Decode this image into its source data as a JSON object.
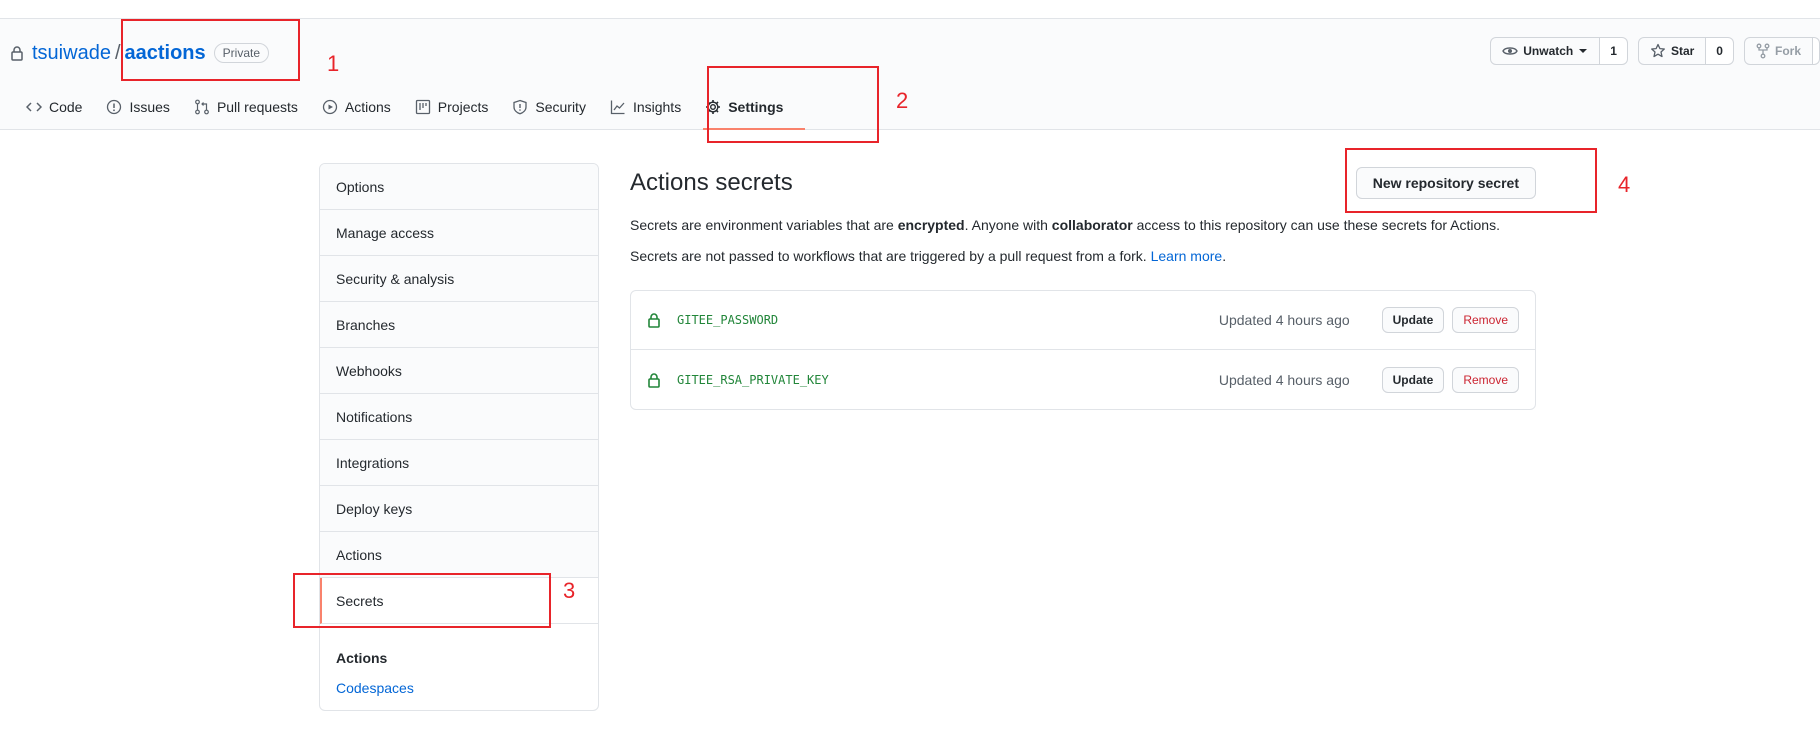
{
  "repo": {
    "owner": "tsuiwade",
    "separator": "/",
    "name": "aactions",
    "visibility": "Private"
  },
  "head_actions": {
    "watch_label": "Unwatch",
    "watch_count": "1",
    "star_label": "Star",
    "star_count": "0",
    "fork_label": "Fork"
  },
  "tabs": [
    {
      "label": "Code",
      "icon": "code-icon"
    },
    {
      "label": "Issues",
      "icon": "issue-icon"
    },
    {
      "label": "Pull requests",
      "icon": "pull-request-icon"
    },
    {
      "label": "Actions",
      "icon": "play-icon"
    },
    {
      "label": "Projects",
      "icon": "project-icon"
    },
    {
      "label": "Security",
      "icon": "shield-icon"
    },
    {
      "label": "Insights",
      "icon": "graph-icon"
    },
    {
      "label": "Settings",
      "icon": "gear-icon",
      "selected": true
    }
  ],
  "sidebar": {
    "items": [
      {
        "label": "Options"
      },
      {
        "label": "Manage access"
      },
      {
        "label": "Security & analysis"
      },
      {
        "label": "Branches"
      },
      {
        "label": "Webhooks"
      },
      {
        "label": "Notifications"
      },
      {
        "label": "Integrations"
      },
      {
        "label": "Deploy keys"
      },
      {
        "label": "Actions"
      },
      {
        "label": "Secrets",
        "selected": true
      }
    ],
    "section_heading": "Actions",
    "section_link": "Codespaces"
  },
  "main": {
    "title": "Actions secrets",
    "new_secret_label": "New repository secret",
    "desc1_a": "Secrets are environment variables that are ",
    "desc1_b": "encrypted",
    "desc1_c": ". Anyone with ",
    "desc1_d": "collaborator",
    "desc1_e": " access to this repository can use these secrets for Actions.",
    "desc2_a": "Secrets are not passed to workflows that are triggered by a pull request from a fork. ",
    "desc2_link": "Learn more",
    "desc2_end": ".",
    "secrets": [
      {
        "name": "GITEE_PASSWORD",
        "updated": "Updated 4 hours ago",
        "update_label": "Update",
        "remove_label": "Remove"
      },
      {
        "name": "GITEE_RSA_PRIVATE_KEY",
        "updated": "Updated 4 hours ago",
        "update_label": "Update",
        "remove_label": "Remove"
      }
    ]
  },
  "annotations": [
    "1",
    "2",
    "3",
    "4"
  ],
  "colors": {
    "link": "#0366d6",
    "accent_underline": "#f9826c",
    "secret_green": "#22863a",
    "danger": "#cb2431",
    "annotation_red": "#e8242a"
  }
}
